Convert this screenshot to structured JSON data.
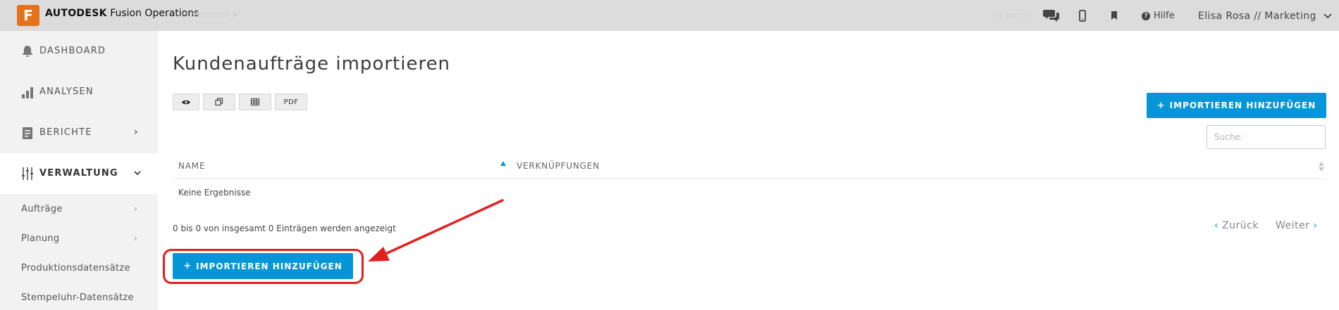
{
  "app": {
    "logo_letter": "F",
    "brand_bold": "AUTODESK",
    "brand_rest": " Fusion Operations"
  },
  "topbar": {
    "help_label": "Hilfe",
    "user_label": "Elisa Rosa // Marketing",
    "icons": [
      "chat-icon",
      "mobile-icon",
      "bookmark-icon",
      "help-icon",
      "chevron-down-icon"
    ]
  },
  "sidebar": {
    "items": [
      {
        "label": "DASHBOARD",
        "icon": "bell-icon"
      },
      {
        "label": "ANALYSEN",
        "icon": "bar-chart-icon"
      },
      {
        "label": "BERICHTE",
        "icon": "document-icon"
      },
      {
        "label": "VERWALTUNG",
        "icon": "sliders-icon"
      }
    ],
    "subitems": [
      {
        "label": "Aufträge"
      },
      {
        "label": "Planung"
      },
      {
        "label": "Produktionsdatensätze"
      },
      {
        "label": "Stempeluhr-Datensätze"
      }
    ]
  },
  "main": {
    "title": "Kundenaufträge importieren",
    "toolbar": {
      "view_icon": "eye-icon",
      "copy_icon": "copy-icon",
      "table_icon": "table-icon",
      "pdf_label": "PDF"
    },
    "add_button_label": "IMPORTIEREN HINZUFÜGEN",
    "search_placeholder": "Suche:",
    "table": {
      "columns": [
        "NAME",
        "VERKNÜPFUNGEN"
      ],
      "empty_text": "Keine Ergebnisse"
    },
    "info_text": "0 bis 0 von insgesamt 0 Einträgen werden angezeigt",
    "pager": {
      "prev": "Zurück",
      "next": "Weiter"
    }
  },
  "colors": {
    "accent": "#0696d7",
    "logo": "#e8711b",
    "annotation": "#e32020",
    "topbar": "#dcdcdc",
    "sidebar": "#f2f2f2"
  }
}
